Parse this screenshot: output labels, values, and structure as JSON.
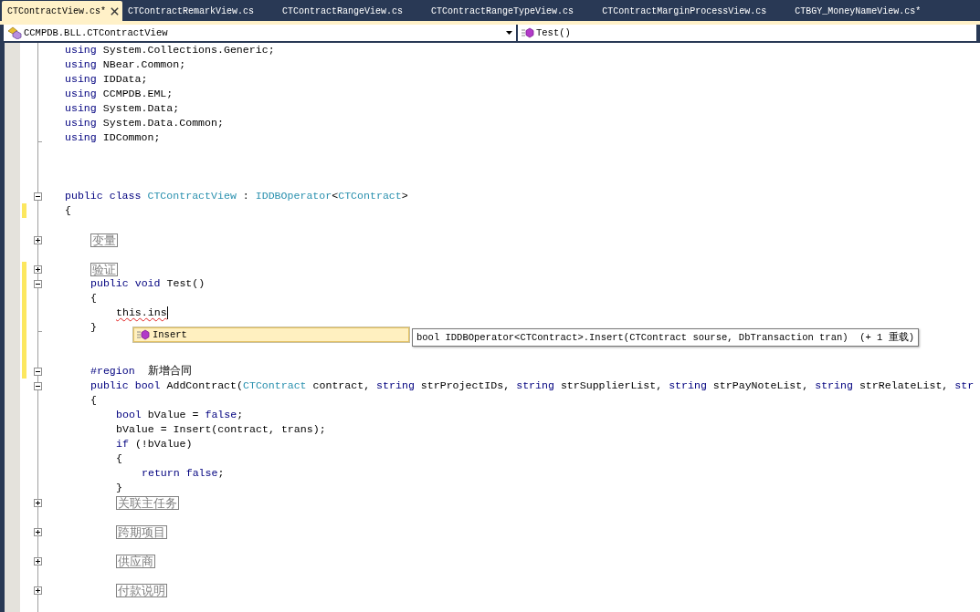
{
  "tabs": [
    {
      "label": "CTContractView.cs*",
      "selected": true
    },
    {
      "label": "CTContractRemarkView.cs",
      "selected": false
    },
    {
      "label": "CTContractRangeView.cs",
      "selected": false
    },
    {
      "label": "CTContractRangeTypeView.cs",
      "selected": false
    },
    {
      "label": "CTContractMarginProcessView.cs",
      "selected": false
    },
    {
      "label": "CTBGY_MoneyNameView.cs*",
      "selected": false
    }
  ],
  "navigation": {
    "type_selector": "CCMPDB.BLL.CTContractView",
    "member_selector": "Test()"
  },
  "editor": {
    "lines": [
      {
        "kind": "code",
        "modified": false,
        "tokens": [
          {
            "kind": "keyword",
            "text": "using"
          },
          {
            "kind": "plain",
            "text": " System.Collections.Generic;"
          }
        ]
      },
      {
        "kind": "code",
        "modified": false,
        "tokens": [
          {
            "kind": "keyword",
            "text": "using"
          },
          {
            "kind": "plain",
            "text": " NBear.Common;"
          }
        ]
      },
      {
        "kind": "code",
        "modified": false,
        "tokens": [
          {
            "kind": "keyword",
            "text": "using"
          },
          {
            "kind": "plain",
            "text": " IDData;"
          }
        ]
      },
      {
        "kind": "code",
        "modified": false,
        "tokens": [
          {
            "kind": "keyword",
            "text": "using"
          },
          {
            "kind": "plain",
            "text": " CCMPDB.EML;"
          }
        ]
      },
      {
        "kind": "code",
        "modified": false,
        "tokens": [
          {
            "kind": "keyword",
            "text": "using"
          },
          {
            "kind": "plain",
            "text": " System.Data;"
          }
        ]
      },
      {
        "kind": "code",
        "modified": false,
        "tokens": [
          {
            "kind": "keyword",
            "text": "using"
          },
          {
            "kind": "plain",
            "text": " System.Data.Common;"
          }
        ]
      },
      {
        "kind": "footer",
        "modified": false,
        "tokens": [
          {
            "kind": "keyword",
            "text": "using"
          },
          {
            "kind": "plain",
            "text": " IDCommon;"
          }
        ]
      },
      {
        "kind": "blank",
        "modified": false
      },
      {
        "kind": "blank",
        "modified": false
      },
      {
        "kind": "blank",
        "modified": false
      },
      {
        "kind": "header",
        "modified": false,
        "tokens": [
          {
            "kind": "keyword",
            "text": "public class "
          },
          {
            "kind": "type",
            "text": "CTContractView"
          },
          {
            "kind": "plain",
            "text": " : "
          },
          {
            "kind": "type",
            "text": "IDDBOperator"
          },
          {
            "kind": "plain",
            "text": "<"
          },
          {
            "kind": "type",
            "text": "CTContract"
          },
          {
            "kind": "plain",
            "text": ">"
          }
        ]
      },
      {
        "kind": "code",
        "modified": true,
        "tokens": [
          {
            "kind": "plain",
            "text": "{"
          }
        ],
        "children": [
          {
            "kind": "blank",
            "modified": false
          },
          {
            "kind": "collapsed",
            "modified": false,
            "label": "变量"
          },
          {
            "kind": "blank",
            "modified": false
          },
          {
            "kind": "collapsed",
            "modified": true,
            "label": "验证"
          },
          {
            "kind": "header",
            "modified": true,
            "tokens": [
              {
                "kind": "keyword",
                "text": "public void"
              },
              {
                "kind": "plain",
                "text": " Test()"
              }
            ]
          },
          {
            "kind": "code",
            "modified": true,
            "tokens": [
              {
                "kind": "plain",
                "text": "{"
              }
            ],
            "children": [
              {
                "kind": "code",
                "modified": true,
                "tokens": [
                  {
                    "kind": "error",
                    "text": "this.ins"
                  },
                  {
                    "kind": "caret"
                  }
                ]
              }
            ]
          },
          {
            "kind": "footer",
            "modified": true,
            "tokens": [
              {
                "kind": "plain",
                "text": "}"
              }
            ]
          },
          {
            "kind": "blank",
            "modified": true
          },
          {
            "kind": "blank",
            "modified": true
          },
          {
            "kind": "header",
            "modified": true,
            "tokens": [
              {
                "kind": "keyword",
                "text": "#region"
              },
              {
                "kind": "plain",
                "text": "  新增合同"
              }
            ]
          },
          {
            "kind": "header",
            "modified": false,
            "tokens": [
              {
                "kind": "keyword",
                "text": "public bool"
              },
              {
                "kind": "plain",
                "text": " AddContract("
              },
              {
                "kind": "type",
                "text": "CTContract"
              },
              {
                "kind": "plain",
                "text": " contract, "
              },
              {
                "kind": "keyword",
                "text": "string"
              },
              {
                "kind": "plain",
                "text": " strProjectIDs, "
              },
              {
                "kind": "keyword",
                "text": "string"
              },
              {
                "kind": "plain",
                "text": " strSupplierList, "
              },
              {
                "kind": "keyword",
                "text": "string"
              },
              {
                "kind": "plain",
                "text": " strPayNoteList, "
              },
              {
                "kind": "keyword",
                "text": "string"
              },
              {
                "kind": "plain",
                "text": " strRelateList, "
              },
              {
                "kind": "keyword",
                "text": "str"
              }
            ]
          },
          {
            "kind": "code",
            "modified": false,
            "tokens": [
              {
                "kind": "plain",
                "text": "{"
              }
            ],
            "children": [
              {
                "kind": "code",
                "modified": false,
                "tokens": [
                  {
                    "kind": "keyword",
                    "text": "bool"
                  },
                  {
                    "kind": "plain",
                    "text": " bValue = "
                  },
                  {
                    "kind": "keyword",
                    "text": "false"
                  },
                  {
                    "kind": "plain",
                    "text": ";"
                  }
                ]
              },
              {
                "kind": "code",
                "modified": false,
                "tokens": [
                  {
                    "kind": "plain",
                    "text": "bValue = Insert(contract, trans);"
                  }
                ]
              },
              {
                "kind": "code",
                "modified": false,
                "tokens": [
                  {
                    "kind": "keyword",
                    "text": "if"
                  },
                  {
                    "kind": "plain",
                    "text": " (!bValue)"
                  }
                ]
              },
              {
                "kind": "code",
                "modified": false,
                "tokens": [
                  {
                    "kind": "plain",
                    "text": "{"
                  }
                ],
                "children": [
                  {
                    "kind": "code",
                    "modified": false,
                    "tokens": [
                      {
                        "kind": "keyword",
                        "text": "return false"
                      },
                      {
                        "kind": "plain",
                        "text": ";"
                      }
                    ]
                  }
                ]
              },
              {
                "kind": "code",
                "modified": false,
                "tokens": [
                  {
                    "kind": "plain",
                    "text": "}"
                  }
                ]
              },
              {
                "kind": "collapsed",
                "modified": false,
                "label": "关联主任务"
              },
              {
                "kind": "blank",
                "modified": false
              },
              {
                "kind": "collapsed",
                "modified": false,
                "label": "跨期项目"
              },
              {
                "kind": "blank",
                "modified": false
              },
              {
                "kind": "collapsed",
                "modified": false,
                "label": "供应商"
              },
              {
                "kind": "blank",
                "modified": false
              },
              {
                "kind": "collapsed",
                "modified": false,
                "label": "付款说明"
              },
              {
                "kind": "blank",
                "modified": false
              }
            ]
          }
        ]
      }
    ],
    "completion": {
      "items": [
        {
          "label": "Insert",
          "selected": true
        }
      ],
      "tooltip": "bool IDDBOperator<CTContract>.Insert(CTContract sourse, DbTransaction tran)  (+ 1 重载)"
    }
  }
}
